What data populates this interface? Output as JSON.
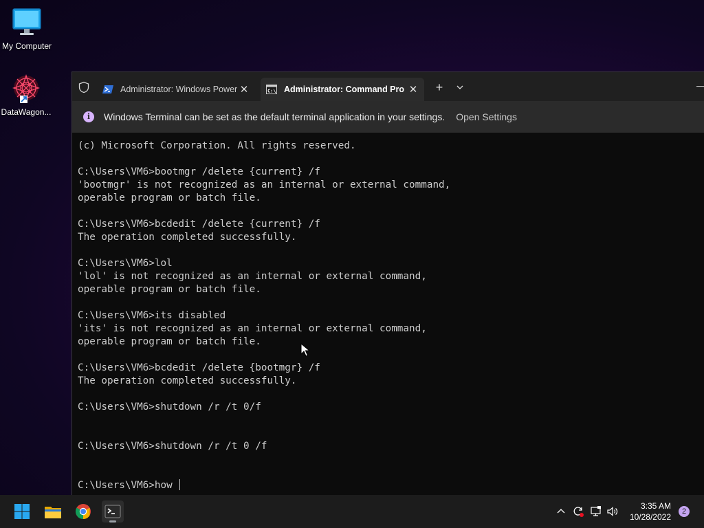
{
  "desktop": {
    "icons": [
      {
        "label": "My Computer",
        "icon": "monitor-icon"
      },
      {
        "label": "DataWagon...",
        "icon": "datawagon-icon"
      }
    ]
  },
  "terminal": {
    "tabs": [
      {
        "title": "Administrator: Windows Power",
        "icon": "powershell-icon",
        "active": false
      },
      {
        "title": "Administrator: Command Pro",
        "icon": "cmd-icon",
        "active": true
      }
    ],
    "new_tab": "+",
    "close_glyph": "✕",
    "infobar": {
      "message": "Windows Terminal can be set as the default terminal application in your settings.",
      "link": "Open Settings",
      "icon": "info-icon"
    },
    "console_lines": [
      "(c) Microsoft Corporation. All rights reserved.",
      "",
      "C:\\Users\\VM6>bootmgr /delete {current} /f",
      "'bootmgr' is not recognized as an internal or external command,",
      "operable program or batch file.",
      "",
      "C:\\Users\\VM6>bcdedit /delete {current} /f",
      "The operation completed successfully.",
      "",
      "C:\\Users\\VM6>lol",
      "'lol' is not recognized as an internal or external command,",
      "operable program or batch file.",
      "",
      "C:\\Users\\VM6>its disabled",
      "'its' is not recognized as an internal or external command,",
      "operable program or batch file.",
      "",
      "C:\\Users\\VM6>bcdedit /delete {bootmgr} /f",
      "The operation completed successfully.",
      "",
      "C:\\Users\\VM6>shutdown /r /t 0/f",
      "",
      "",
      "C:\\Users\\VM6>shutdown /r /t 0 /f",
      "",
      "",
      "C:\\Users\\VM6>how "
    ]
  },
  "taskbar": {
    "apps": [
      "start-icon",
      "file-explorer-icon",
      "chrome-icon",
      "terminal-icon"
    ],
    "clock": {
      "time": "3:35 AM",
      "date": "10/28/2022"
    },
    "notification_count": "2"
  },
  "colors": {
    "console_bg": "#0c0c0c",
    "console_fg": "#cccccc",
    "accent": "#c4a4f0"
  }
}
